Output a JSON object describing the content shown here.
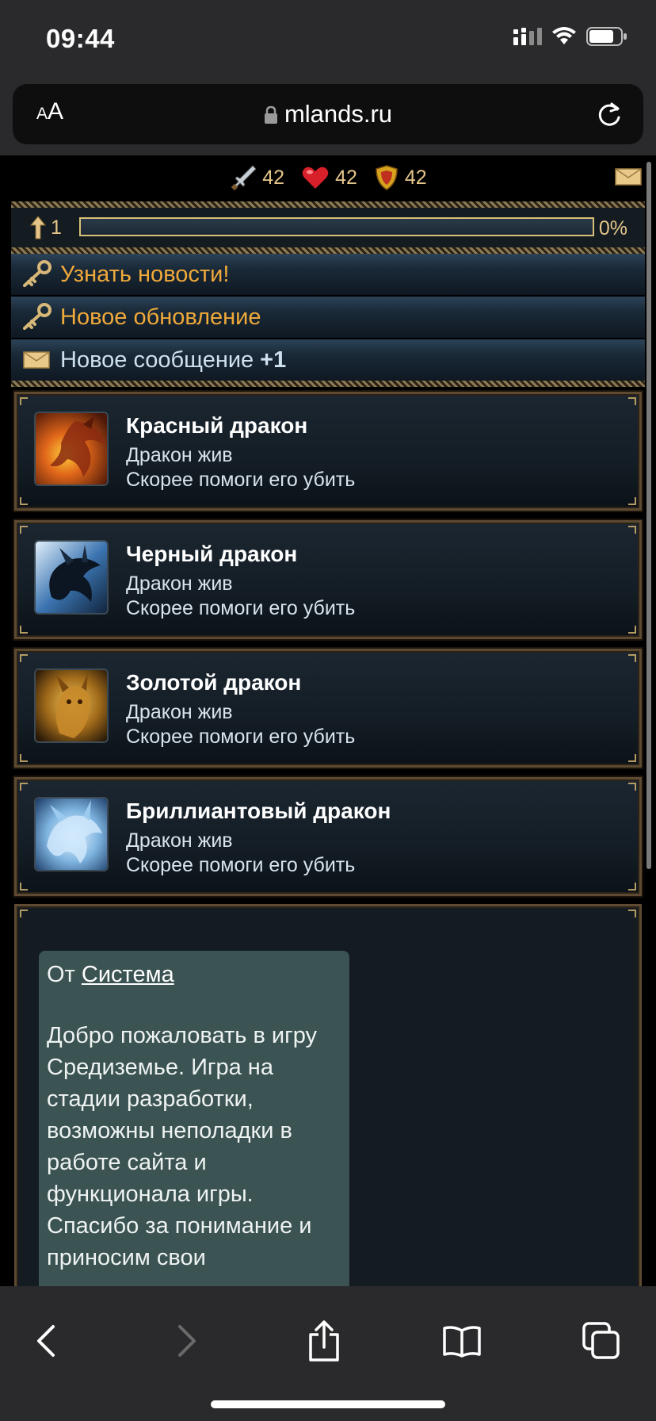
{
  "status_bar": {
    "time": "09:44"
  },
  "browser": {
    "aa_small": "A",
    "aa_large": "A",
    "url": "mlands.ru"
  },
  "stats": {
    "attack": "42",
    "health": "42",
    "defense": "42"
  },
  "level": {
    "value": "1",
    "progress_percent": "0%",
    "progress_fraction": 0
  },
  "news": [
    {
      "label": "Узнать новости!"
    },
    {
      "label": "Новое обновление"
    },
    {
      "label": "Новое сообщение",
      "count": "+1"
    }
  ],
  "dragons": [
    {
      "name": "Красный дракон",
      "status": "Дракон жив",
      "hint": "Скорее помоги его убить",
      "color": "#c0461e"
    },
    {
      "name": "Черный дракон",
      "status": "Дракон жив",
      "hint": "Скорее помоги его убить",
      "color": "#3a6a9a"
    },
    {
      "name": "Золотой дракон",
      "status": "Дракон жив",
      "hint": "Скорее помоги его убить",
      "color": "#b8892a"
    },
    {
      "name": "Бриллиантовый дракон",
      "status": "Дракон жив",
      "hint": "Скорее помоги его убить",
      "color": "#6fa8d8"
    }
  ],
  "message": {
    "from_prefix": "От",
    "sender": "Система",
    "text": "Добро пожаловать в игру Средиземье. Игра на стадии разработки, возможны неполадки в работе сайта и функционала игры. Спасибо за понимание и приносим свои"
  },
  "icons": {
    "signal": "signal-icon",
    "wifi": "wifi-icon",
    "battery": "battery-icon",
    "lock": "lock-icon",
    "reload": "reload-icon",
    "sword": "sword-icon",
    "heart": "heart-icon",
    "shield": "shield-icon",
    "mail": "mail-icon",
    "arrow_up": "level-arrow-icon",
    "key": "key-icon",
    "back": "back-icon",
    "forward": "forward-icon",
    "share": "share-icon",
    "bookmarks": "bookmarks-icon",
    "tabs": "tabs-icon"
  }
}
